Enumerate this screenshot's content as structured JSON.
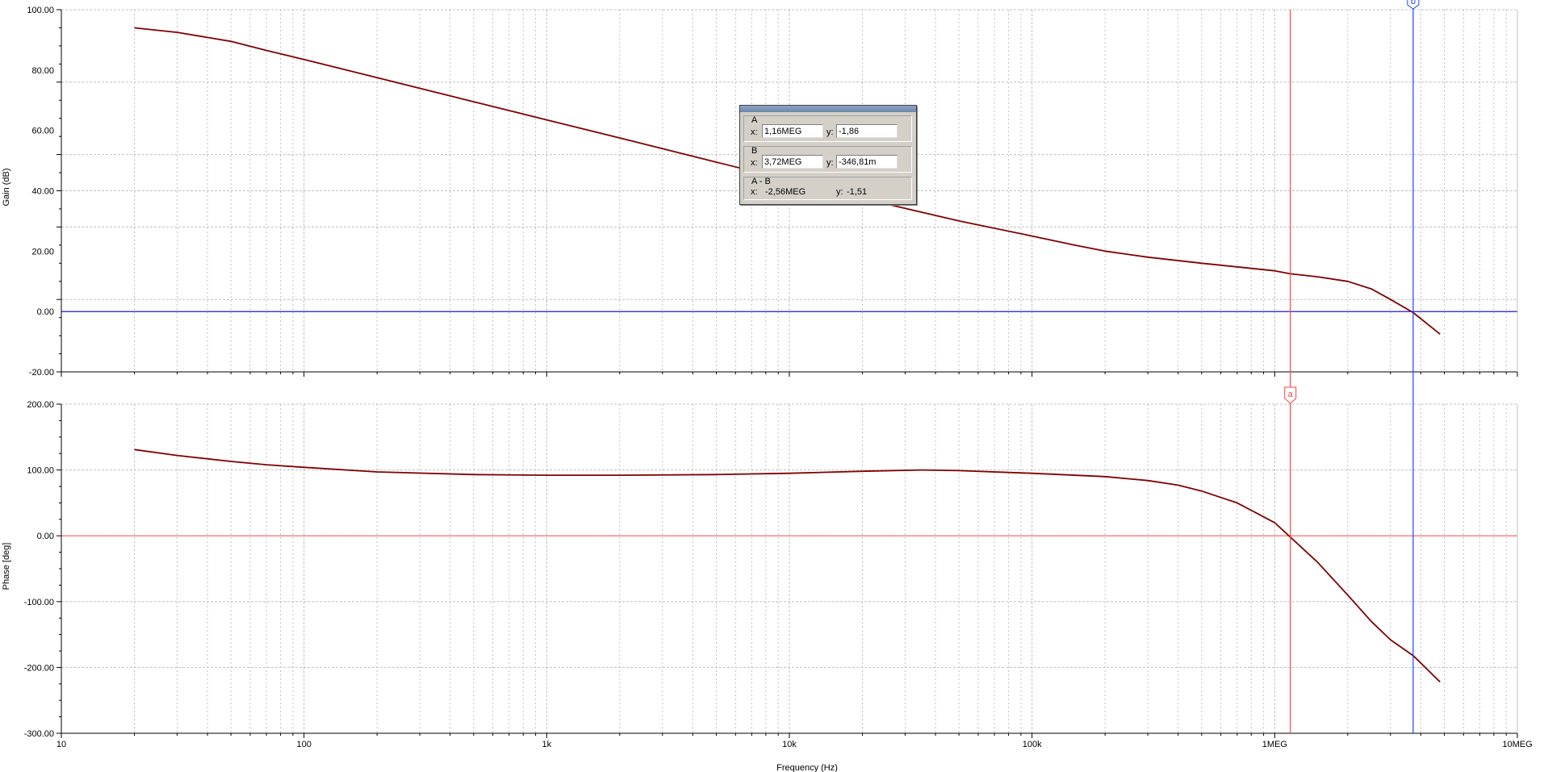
{
  "chart_data": [
    {
      "type": "line",
      "title": "",
      "xlabel": "",
      "ylabel": "Gain (dB)",
      "xscale": "log",
      "xlim": [
        10,
        10000000
      ],
      "ylim": [
        -20,
        100
      ],
      "ytick_labels": [
        "100.00",
        "80.00",
        "60.00",
        "40.00",
        "20.00",
        "0.00",
        "-20.00"
      ],
      "yticks": [
        100,
        80,
        60,
        40,
        20,
        0,
        -20
      ],
      "grid": true,
      "colors": {
        "trace": "#800000",
        "zero_line": "#0000cc",
        "grid": "#c0c0c0"
      },
      "series": [
        {
          "x": [
            20,
            30,
            50,
            70,
            100,
            200,
            500,
            1000,
            2000,
            5000,
            10000,
            20000,
            50000,
            100000,
            150000,
            200000,
            300000,
            500000,
            1000000,
            1160000,
            1500000,
            2000000,
            2500000,
            3000000,
            3720000,
            4800000
          ],
          "y": [
            94,
            92.5,
            89.5,
            86.5,
            83.5,
            77.5,
            69.5,
            63.5,
            57.5,
            49.5,
            43.5,
            37.5,
            30,
            25,
            22,
            20,
            18,
            16,
            13.5,
            12.5,
            11.5,
            10,
            7.5,
            4,
            -0.35,
            -7.5
          ]
        }
      ]
    },
    {
      "type": "line",
      "title": "",
      "xlabel": "Frequency (Hz)",
      "ylabel": "Phase [deg]",
      "xscale": "log",
      "xlim": [
        10,
        10000000
      ],
      "ylim": [
        -300,
        200
      ],
      "xtick_labels": [
        "10",
        "100",
        "1k",
        "10k",
        "100k",
        "1MEG",
        "10MEG"
      ],
      "xticks": [
        10,
        100,
        1000,
        10000,
        100000,
        1000000,
        10000000
      ],
      "ytick_labels": [
        "200.00",
        "100.00",
        "0.00",
        "-100.00",
        "-200.00",
        "-300.00"
      ],
      "yticks": [
        200,
        100,
        0,
        -100,
        -200,
        -300
      ],
      "grid": true,
      "colors": {
        "trace": "#800000",
        "zero_line": "#ff6060",
        "grid": "#c0c0c0"
      },
      "series": [
        {
          "x": [
            20,
            30,
            50,
            70,
            100,
            200,
            500,
            1000,
            2000,
            5000,
            10000,
            20000,
            35000,
            50000,
            100000,
            200000,
            300000,
            400000,
            500000,
            700000,
            1000000,
            1160000,
            1500000,
            2000000,
            2500000,
            3000000,
            3720000,
            4800000
          ],
          "y": [
            131,
            122,
            113,
            108,
            104,
            97,
            93,
            92,
            92,
            93,
            95,
            98,
            100,
            99,
            95,
            90,
            84,
            77,
            68,
            50,
            20,
            -2,
            -40,
            -90,
            -130,
            -158,
            -182,
            -222
          ]
        }
      ]
    }
  ],
  "cursors": {
    "a": {
      "label": "a",
      "x": 1160000,
      "color": "#ff4040"
    },
    "b": {
      "label": "b",
      "x": 3720000,
      "color": "#2040ff"
    }
  },
  "cursor_panel": {
    "a": {
      "caption": "A",
      "x_label": "x:",
      "x_value": "1,16MEG",
      "y_label": "y:",
      "y_value": "-1,86"
    },
    "b": {
      "caption": "B",
      "x_label": "x:",
      "x_value": "3,72MEG",
      "y_label": "y:",
      "y_value": "-346,81m"
    },
    "diff": {
      "caption": "A - B",
      "x_label": "x:",
      "x_value": "-2,56MEG",
      "y_label": "y:",
      "y_value": "-1,51"
    }
  }
}
